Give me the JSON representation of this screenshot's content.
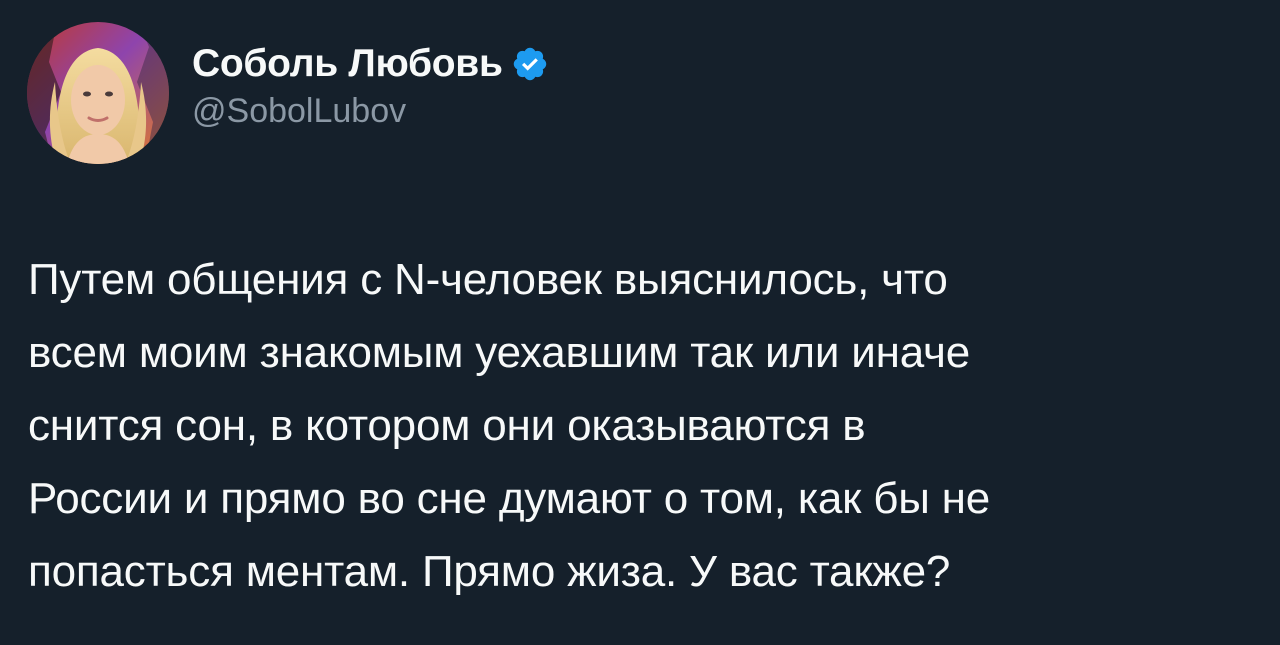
{
  "author": {
    "display_name": "Соболь Любовь",
    "handle": "@SobolLubov",
    "verified_icon": "verified-badge-icon",
    "avatar_icon": "profile-photo"
  },
  "tweet": {
    "lines": [
      "Путем общения с N-человек выяснилось, что",
      "всем моим знакомым уехавшим так или иначе",
      "снится сон, в котором они оказываются в",
      "России и прямо во сне думают о том, как бы не",
      "попасться ментам. Прямо жиза. У вас также?"
    ]
  },
  "colors": {
    "background": "#15202b",
    "text": "#f7f9f9",
    "secondary_text": "#8b98a5",
    "verified_blue": "#1d9bf0"
  }
}
